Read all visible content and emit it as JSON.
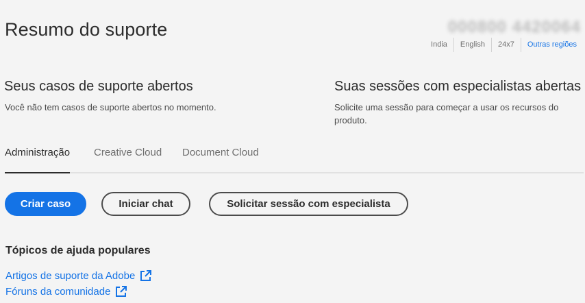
{
  "header": {
    "title": "Resumo do suporte",
    "phone": "000800 4420064"
  },
  "region_bar": {
    "items": [
      "India",
      "English",
      "24x7"
    ],
    "link": "Outras regiões"
  },
  "cases": {
    "title": "Seus casos de suporte abertos",
    "text": "Você não tem casos de suporte abertos no momento."
  },
  "sessions": {
    "title": "Suas sessões com especialistas abertas",
    "text_line1": "Solicite uma sessão para começar a usar os recursos do",
    "text_line2": "produto."
  },
  "tabs": [
    {
      "label": "Administração",
      "active": true
    },
    {
      "label": "Creative Cloud",
      "active": false
    },
    {
      "label": "Document Cloud",
      "active": false
    }
  ],
  "actions": {
    "create_case": "Criar caso",
    "start_chat": "Iniciar chat",
    "request_session": "Solicitar sessão com especialista"
  },
  "help": {
    "title": "Tópicos de ajuda populares",
    "links": [
      {
        "label": "Artigos de suporte da Adobe",
        "icon": "external-link-icon"
      },
      {
        "label": "Fóruns da comunidade",
        "icon": "external-link-icon"
      }
    ]
  },
  "colors": {
    "accent": "#1473e6",
    "background": "#f4f4f4",
    "text": "#2c2c2c"
  }
}
